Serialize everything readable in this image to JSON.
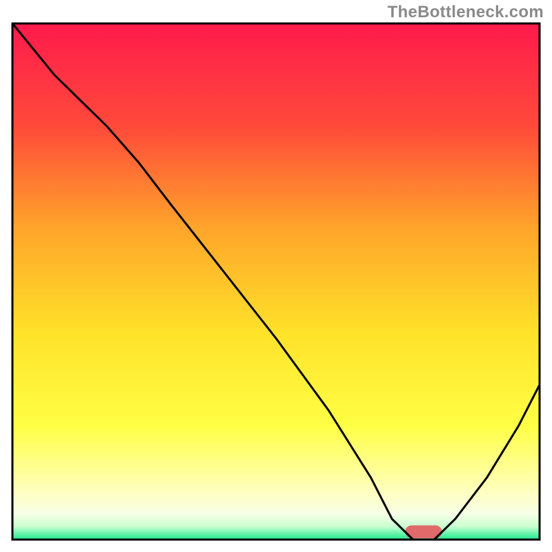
{
  "watermark": "TheBottleneck.com",
  "chart_data": {
    "type": "line",
    "title": "",
    "xlabel": "",
    "ylabel": "",
    "xlim": [
      0,
      100
    ],
    "ylim": [
      0,
      100
    ],
    "axes_visible": false,
    "legend": false,
    "background_gradient": {
      "stops": [
        {
          "at": 0.0,
          "color": "#ff1a4c"
        },
        {
          "at": 0.2,
          "color": "#ff4a3a"
        },
        {
          "at": 0.4,
          "color": "#ffa62a"
        },
        {
          "at": 0.6,
          "color": "#ffe22a"
        },
        {
          "at": 0.78,
          "color": "#ffff45"
        },
        {
          "at": 0.9,
          "color": "#ffffb8"
        },
        {
          "at": 0.95,
          "color": "#f7ffe6"
        },
        {
          "at": 0.975,
          "color": "#c9ffd0"
        },
        {
          "at": 0.99,
          "color": "#5cf3a8"
        },
        {
          "at": 1.0,
          "color": "#25ea8e"
        }
      ]
    },
    "series": [
      {
        "name": "bottleneck-curve",
        "stroke": "#000000",
        "stroke_width": 3,
        "x": [
          0,
          8,
          18,
          24,
          30,
          40,
          50,
          60,
          68,
          72,
          76,
          80,
          84,
          90,
          96,
          100
        ],
        "y": [
          100,
          90,
          80,
          73,
          65,
          52,
          39,
          25,
          12,
          4,
          0,
          0,
          4,
          12,
          22,
          30
        ]
      }
    ],
    "markers": [
      {
        "name": "optimal-zone",
        "shape": "rounded-rect",
        "fill": "#e06a6a",
        "x_center": 78,
        "width_x": 7,
        "y_center": 1.5,
        "height_y": 2.5
      }
    ],
    "frame": {
      "stroke": "#000000",
      "stroke_width": 3
    }
  }
}
